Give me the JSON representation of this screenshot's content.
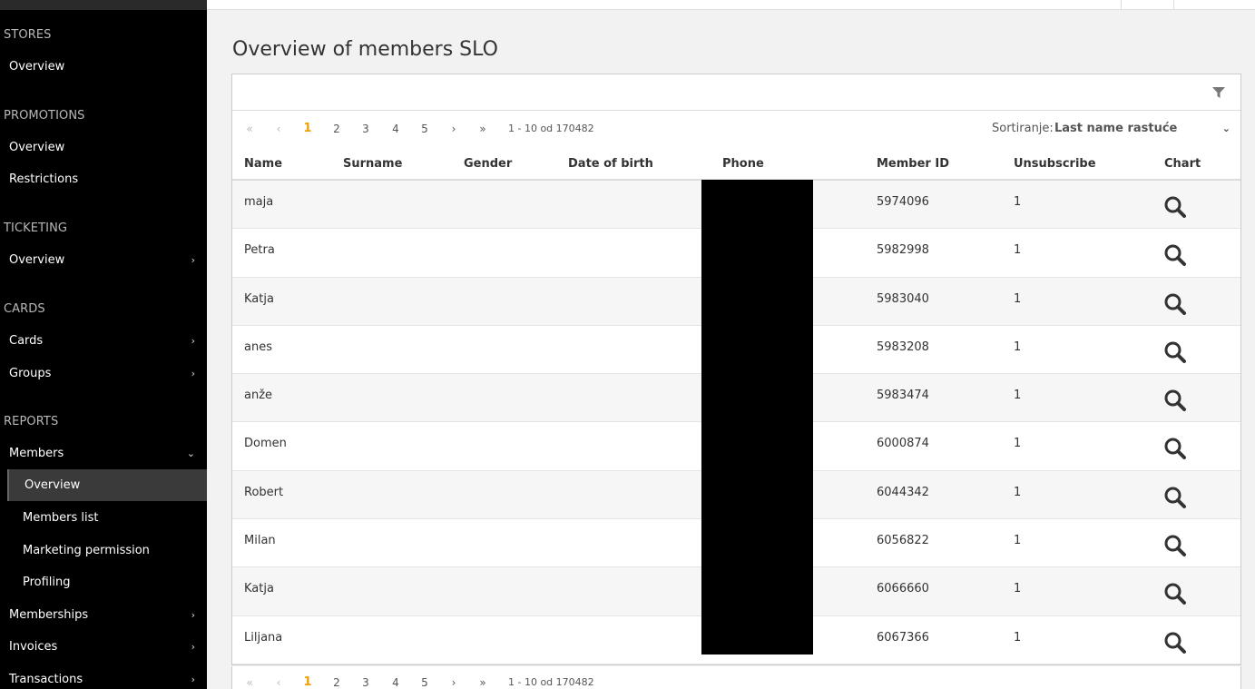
{
  "sidebar": {
    "sections": {
      "stores": "STORES",
      "promotions": "PROMOTIONS",
      "ticketing": "TICKETING",
      "cards": "CARDS",
      "reports": "REPORTS"
    },
    "items": {
      "stores_overview": "Overview",
      "promotions_overview": "Overview",
      "restrictions": "Restrictions",
      "ticketing_overview": "Overview",
      "cards": "Cards",
      "groups": "Groups",
      "members": "Members",
      "members_overview": "Overview",
      "members_list": "Members list",
      "marketing_permission": "Marketing permission",
      "profiling": "Profiling",
      "memberships": "Memberships",
      "invoices": "Invoices",
      "transactions": "Transactions"
    }
  },
  "page": {
    "title": "Overview of members SLO"
  },
  "pager": {
    "first": "«",
    "prev": "‹",
    "pages": [
      "1",
      "2",
      "3",
      "4",
      "5"
    ],
    "current": "1",
    "next": "›",
    "last": "»",
    "info": "1 - 10 od 170482"
  },
  "sort": {
    "label": "Sortiranje:",
    "value": "Last name rastuće"
  },
  "table": {
    "headers": [
      "Name",
      "Surname",
      "Gender",
      "Date of birth",
      "Phone",
      "Member ID",
      "Unsubscribe",
      "Chart"
    ],
    "rows": [
      {
        "name": "maja",
        "member_id": "5974096",
        "unsubscribe": "1"
      },
      {
        "name": "Petra",
        "member_id": "5982998",
        "unsubscribe": "1"
      },
      {
        "name": "Katja",
        "member_id": "5983040",
        "unsubscribe": "1"
      },
      {
        "name": "anes",
        "member_id": "5983208",
        "unsubscribe": "1"
      },
      {
        "name": "anže",
        "member_id": "5983474",
        "unsubscribe": "1"
      },
      {
        "name": "Domen",
        "member_id": "6000874",
        "unsubscribe": "1"
      },
      {
        "name": "Robert",
        "member_id": "6044342",
        "unsubscribe": "1"
      },
      {
        "name": "Milan",
        "member_id": "6056822",
        "unsubscribe": "1"
      },
      {
        "name": "Katja",
        "member_id": "6066660",
        "unsubscribe": "1"
      },
      {
        "name": "Liljana",
        "member_id": "6067366",
        "unsubscribe": "1"
      }
    ]
  },
  "colors": {
    "accent": "#f0a000",
    "sidebar_bg": "#000000",
    "active_bg": "#3a3a3a"
  },
  "icons": {
    "filter": "filter-icon",
    "chart": "search-icon",
    "chevron": "chevron-right-icon"
  }
}
